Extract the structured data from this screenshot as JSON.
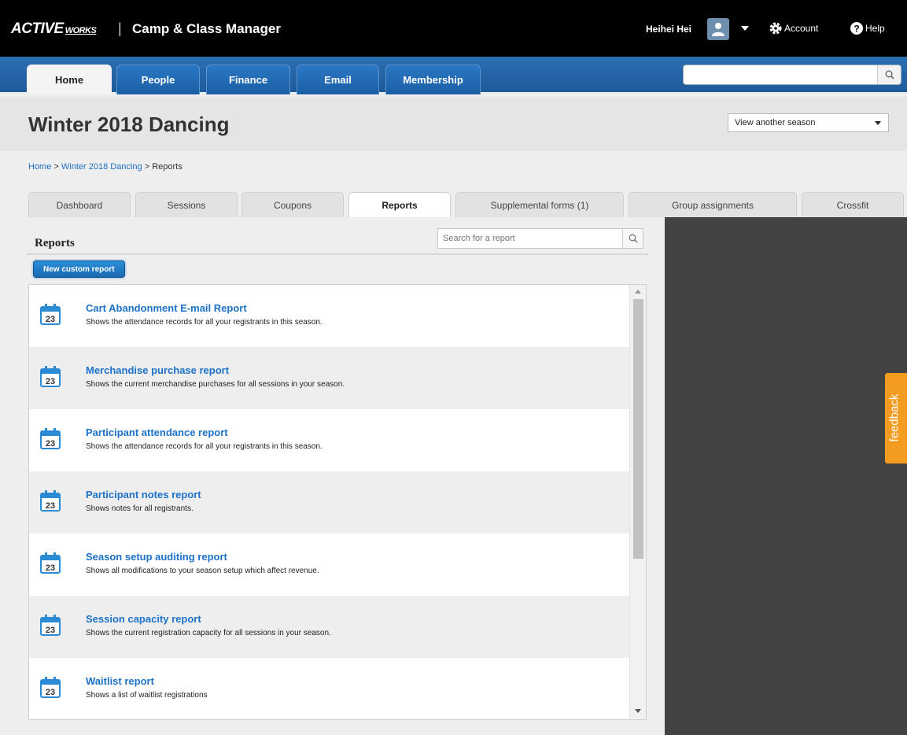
{
  "header": {
    "logo_main": "ACTIVE",
    "logo_works": "WORKS",
    "separator": "|",
    "app_title": "Camp & Class Manager",
    "user_name": "Heihei Hei",
    "account_label": "Account",
    "help_label": "Help"
  },
  "nav": {
    "tabs": [
      {
        "label": "Home"
      },
      {
        "label": "People"
      },
      {
        "label": "Finance"
      },
      {
        "label": "Email"
      },
      {
        "label": "Membership"
      }
    ],
    "search_value": ""
  },
  "season": {
    "title": "Winter 2018 Dancing",
    "selector_value": "View another season"
  },
  "breadcrumb": {
    "home": "Home",
    "sep1": ">",
    "season": "Winter 2018 Dancing",
    "sep2": ">",
    "current": "Reports"
  },
  "subtabs": [
    {
      "label": "Dashboard"
    },
    {
      "label": "Sessions"
    },
    {
      "label": "Coupons"
    },
    {
      "label": "Reports"
    },
    {
      "label": "Supplemental forms (1)"
    },
    {
      "label": "Group assignments"
    },
    {
      "label": "Crossfit"
    }
  ],
  "reports": {
    "title": "Reports",
    "search_placeholder": "Search for a report",
    "new_button": "New custom report",
    "icon_day": "23",
    "items": [
      {
        "title": "Cart Abandonment E-mail Report",
        "desc": "Shows the attendance records for all your registrants in this season."
      },
      {
        "title": "Merchandise purchase report",
        "desc": "Shows the current merchandise purchases for all sessions in your season."
      },
      {
        "title": "Participant attendance report",
        "desc": "Shows the attendance records for all your registrants in this season."
      },
      {
        "title": "Participant notes report",
        "desc": "Shows notes for all registrants."
      },
      {
        "title": "Season setup auditing report",
        "desc": "Shows all modifications to your season setup which affect revenue."
      },
      {
        "title": "Session capacity report",
        "desc": "Shows the current registration capacity for all sessions in your season."
      },
      {
        "title": "Waitlist report",
        "desc": "Shows a list of waitlist registrations"
      }
    ]
  },
  "feedback_label": "feedback",
  "colors": {
    "nav_blue": "#1d5a9a",
    "link_blue": "#1d72c7",
    "feedback_orange": "#f39c20",
    "dark_panel": "#434343"
  }
}
